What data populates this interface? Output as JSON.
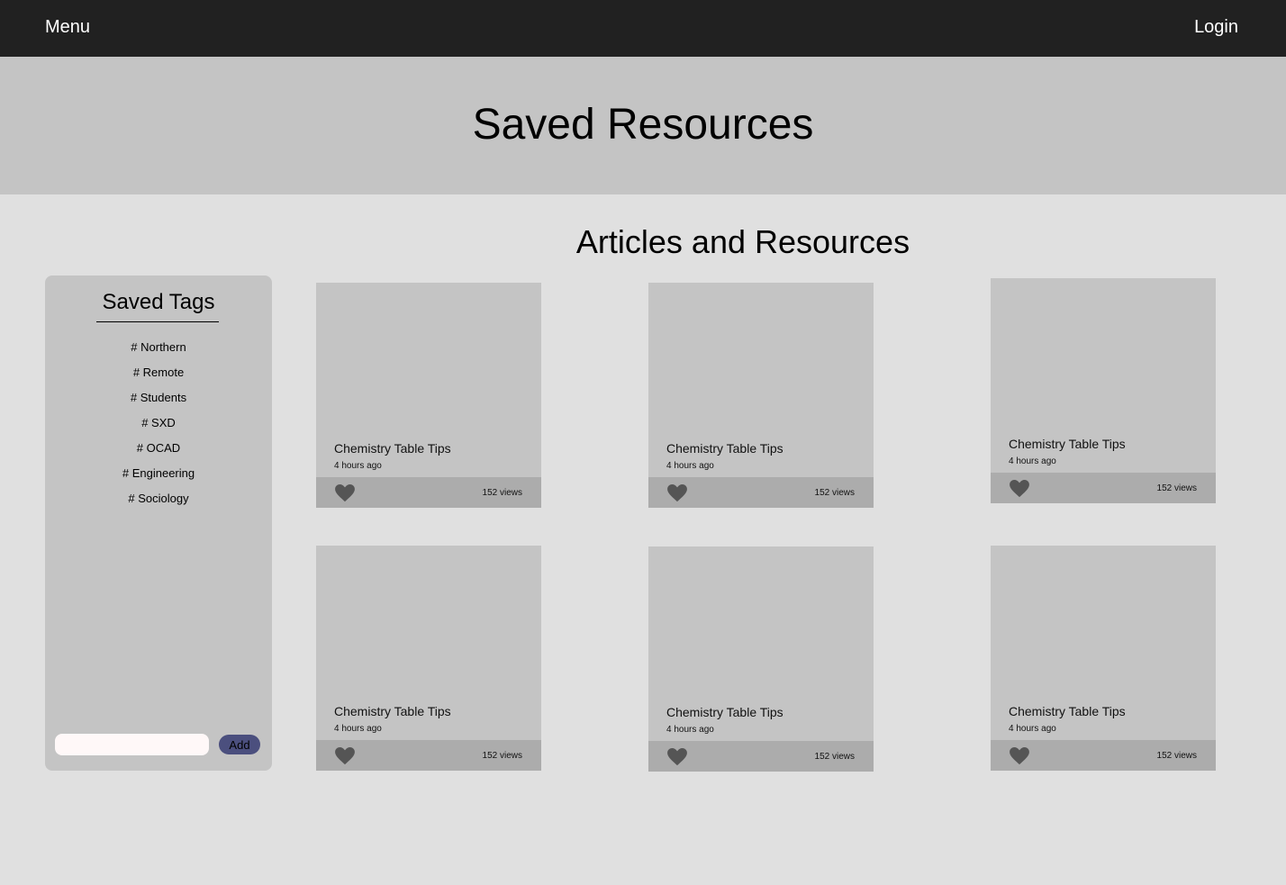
{
  "nav": {
    "menu_label": "Menu",
    "login_label": "Login"
  },
  "hero": {
    "title": "Saved Resources"
  },
  "main": {
    "section_title": "Articles and Resources"
  },
  "sidebar": {
    "title": "Saved Tags",
    "tags": [
      "# Northern",
      "# Remote",
      "# Students",
      "# SXD",
      "# OCAD",
      "# Engineering",
      "# Sociology"
    ],
    "input_value": "",
    "add_label": "Add"
  },
  "cards": [
    {
      "title": "Chemistry Table Tips",
      "time": "4 hours ago",
      "views": "152 views",
      "icon": "heart-icon"
    },
    {
      "title": "Chemistry Table Tips",
      "time": "4 hours ago",
      "views": "152 views",
      "icon": "heart-icon"
    },
    {
      "title": "Chemistry Table Tips",
      "time": "4 hours ago",
      "views": "152 views",
      "icon": "heart-icon"
    },
    {
      "title": "Chemistry Table Tips",
      "time": "4 hours ago",
      "views": "152 views",
      "icon": "heart-icon"
    },
    {
      "title": "Chemistry Table Tips",
      "time": "4 hours ago",
      "views": "152 views",
      "icon": "heart-icon"
    },
    {
      "title": "Chemistry Table Tips",
      "time": "4 hours ago",
      "views": "152 views",
      "icon": "heart-icon"
    }
  ],
  "colors": {
    "topbar": "#212121",
    "hero": "#c4c4c4",
    "page": "#e0e0e0",
    "card": "#c4c4c4",
    "card_footer": "#acacac",
    "heart": "#555555",
    "add_button": "#4b4f7e"
  }
}
